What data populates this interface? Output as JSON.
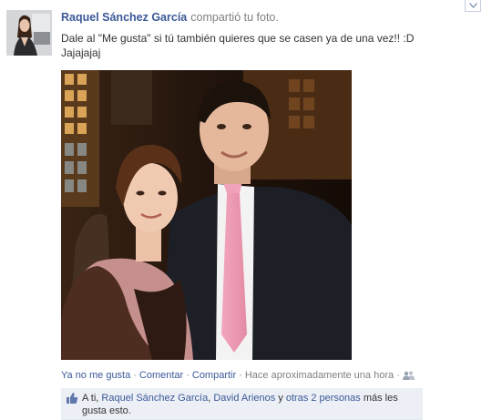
{
  "post": {
    "author": "Raquel Sánchez García",
    "action": "compartió tu foto.",
    "message_line1": "Dale al \"Me gusta\" si tú también quieres que se casen ya de una vez!! :D",
    "message_line2": "Jajajajaj"
  },
  "footer": {
    "unlike": "Ya no me gusta",
    "sep1": "·",
    "comment": "Comentar",
    "sep2": "·",
    "share": "Compartir",
    "sep3": "·",
    "timestamp": "Hace aproximadamente una hora",
    "sep4": "·"
  },
  "likes": {
    "prefix": "A ti, ",
    "person1": "Raquel Sánchez García",
    "comma": ", ",
    "person2": "David Arienos",
    "middle": " y ",
    "others": "otras 2 personas",
    "suffix": " más les gusta esto."
  },
  "colors": {
    "link": "#3b5998",
    "muted": "#808080",
    "like_bg": "#eceff5"
  },
  "icons": {
    "audience": "friends-icon",
    "like": "thumbs-up-icon",
    "menu": "chevron-down-icon"
  }
}
